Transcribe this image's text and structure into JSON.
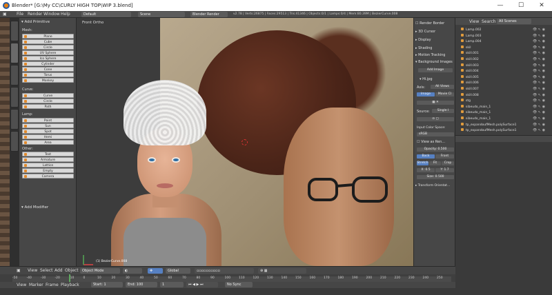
{
  "window": {
    "title": "Blender* [G:\\My CC\\CURLY HIGH TOP\\WIP 3.blend]",
    "minimize": "—",
    "maximize": "☐",
    "close": "✕"
  },
  "infobar": {
    "menus": [
      "File",
      "Render",
      "Window",
      "Help"
    ],
    "layout": "Default",
    "scene": "Scene",
    "engine": "Blender Render",
    "stats": "v2.78 | Verts:26875 | Faces:29513 | Tris:41346 | Objects:0/1 | Lamps:0/4 | Mem:80.39M | BezierCurve.008"
  },
  "toolshelf": {
    "panel_title": "Add Primitive",
    "groups": [
      {
        "label": "Mesh:",
        "items": [
          "Plane",
          "Cube",
          "Circle",
          "UV Sphere",
          "Ico Sphere",
          "Cylinder",
          "Cone",
          "Torus",
          "Monkey"
        ]
      },
      {
        "label": "Curve:",
        "items": [
          "Curve",
          "Circle",
          "Path"
        ]
      },
      {
        "label": "Lamp:",
        "items": [
          "Point",
          "Sun",
          "Spot",
          "Hemi",
          "Area"
        ]
      },
      {
        "label": "Other:",
        "items": [
          "Text",
          "Armature",
          "Lattice",
          "Empty",
          "Camera"
        ]
      }
    ],
    "modifier_panel": "Add Modifier",
    "tabs": [
      "Tools",
      "Create",
      "Relations",
      "Animation",
      "Physics",
      "Grease Pencil"
    ]
  },
  "viewport": {
    "view_label": "Front Ortho",
    "object_label": "(1) BezierCurve.008",
    "header": {
      "menus": [
        "View",
        "Select",
        "Add",
        "Object"
      ],
      "mode": "Object Mode",
      "orientation": "Global"
    }
  },
  "timeline": {
    "ticks": [
      "-50",
      "-40",
      "-30",
      "-20",
      "-10",
      "0",
      "10",
      "20",
      "30",
      "40",
      "50",
      "60",
      "70",
      "80",
      "90",
      "100",
      "110",
      "120",
      "130",
      "140",
      "150",
      "160",
      "170",
      "180",
      "190",
      "200",
      "210",
      "220",
      "230",
      "240",
      "250"
    ],
    "menus": [
      "View",
      "Marker",
      "Frame",
      "Playback"
    ],
    "start_label": "Start:",
    "start_value": "1",
    "end_label": "End:",
    "end_value": "100",
    "current_frame": "1",
    "sync": "No Sync"
  },
  "properties": {
    "sections": [
      "Render Border",
      "3D Cursor",
      "Display",
      "Shading",
      "Motion Tracking",
      "Background Images"
    ],
    "add_image": "Add Image",
    "image_name": "Hi.jpg",
    "axis_label": "Axis:",
    "axis_value": "All Views",
    "source_image": "Image",
    "source_clip": "Movie Cl",
    "source_label": "Source:",
    "source_value": "Single I",
    "input_color_space": "Input Color Space:",
    "color_space": "sRGB",
    "view_as_render": "View as Ren...",
    "opacity_label": "Opacity:",
    "opacity_value": "0.500",
    "back": "Back",
    "front": "Front",
    "stretch": "Stretch",
    "fit": "Fit",
    "crop": "Crop",
    "x_label": "X:",
    "x_value": "0.5",
    "y_label": "Y:",
    "y_value": "1.7",
    "size_label": "Size:",
    "size_value": "0.500",
    "transform_orientations": "Transform Orientat..."
  },
  "outliner": {
    "header": {
      "view": "View",
      "search": "Search",
      "scope": "All Scenes"
    },
    "rows": [
      "Lamp.002",
      "Lamp.003",
      "Lamp.004",
      "skil",
      "skill.001",
      "skill.002",
      "skill.003",
      "skill.004",
      "skill.005",
      "skill.006",
      "skill.007",
      "skill.008",
      "stg",
      "sibeudo_main_1",
      "sibeudo_main_1",
      "sibeudo_main_1",
      "tp_expandoufMesh.polySurface1",
      "tp_expandoufMesh.polySurface1"
    ]
  }
}
